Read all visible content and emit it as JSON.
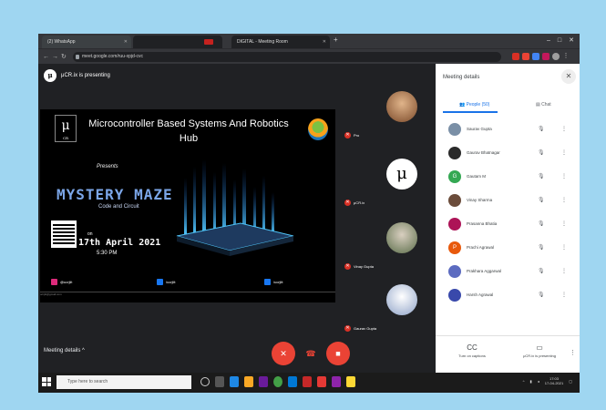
{
  "browser": {
    "tabs": [
      {
        "label": "(2) WhatsApp"
      },
      {
        "label": ""
      },
      {
        "label": "DIGITAL - Meeting Room"
      }
    ],
    "url": "meet.google.com/ruu-xpjd-cvc",
    "window_controls": [
      "–",
      "□",
      "✕"
    ]
  },
  "meeting": {
    "presenting_label": "μCR.ix is presenting",
    "presenter_initial": "μ",
    "details_label": "Meeting details",
    "details_caret": "^"
  },
  "slide": {
    "logo": "μ",
    "logo_sub": "CR",
    "title": "Microcontroller Based Systems And Robotics Hub",
    "presents": "Presents",
    "event_name": "MYSTERY MAZE",
    "event_sub": "Code and Circuit",
    "on": "on",
    "date": "17th April 2021",
    "time": "5:30 PM",
    "social": [
      {
        "label": "@ucrjiit",
        "color": "#dd2a7b"
      },
      {
        "label": "/ucrjiit",
        "color": "#1877f2"
      },
      {
        "label": "/ucrjiit",
        "color": "#1877f2"
      }
    ],
    "footer": "ucrjiit@gmail.com"
  },
  "tiles": [
    {
      "name": "Pro",
      "color": "#c0824a"
    },
    {
      "name": "μCR.ix",
      "color": "#ffffff"
    },
    {
      "name": "Vinay Gupta",
      "color": "#9c8f7a"
    },
    {
      "name": "Gaurav Gupta",
      "color": "#e6e6f0"
    }
  ],
  "controls": {
    "mic_icon": "mic-off-icon",
    "end_call_icon": "end-call-icon",
    "camera_icon": "camera-off-icon"
  },
  "panel": {
    "title": "Meeting details",
    "close": "✕",
    "people_tab": "People (50)",
    "chat_tab": "Chat",
    "people": [
      {
        "name": "Saurav Gupta",
        "initial": "",
        "color": "#7a8fa6"
      },
      {
        "name": "Gaurav Bhatnagar",
        "initial": "",
        "color": "#2a2a2a"
      },
      {
        "name": "Gautam M",
        "initial": "G",
        "color": "#34a853"
      },
      {
        "name": "Vinay Sharma",
        "initial": "",
        "color": "#6b4c3b"
      },
      {
        "name": "Prasanna Bhatia",
        "initial": "",
        "color": "#ad1457"
      },
      {
        "name": "Prachi Agrawal",
        "initial": "P",
        "color": "#e8590c"
      },
      {
        "name": "Prakhara Aggarwal",
        "initial": "",
        "color": "#5c6bc0"
      },
      {
        "name": "Harsh Agrawal",
        "initial": "",
        "color": "#3949ab"
      }
    ],
    "bottom": [
      {
        "label": "Turn on captions",
        "icon": "CC"
      },
      {
        "label": "μCR.ix is presenting",
        "icon": "▭"
      }
    ]
  },
  "taskbar": {
    "search_placeholder": "Type here to search",
    "time": "17:03",
    "date": "17-04-2021"
  }
}
